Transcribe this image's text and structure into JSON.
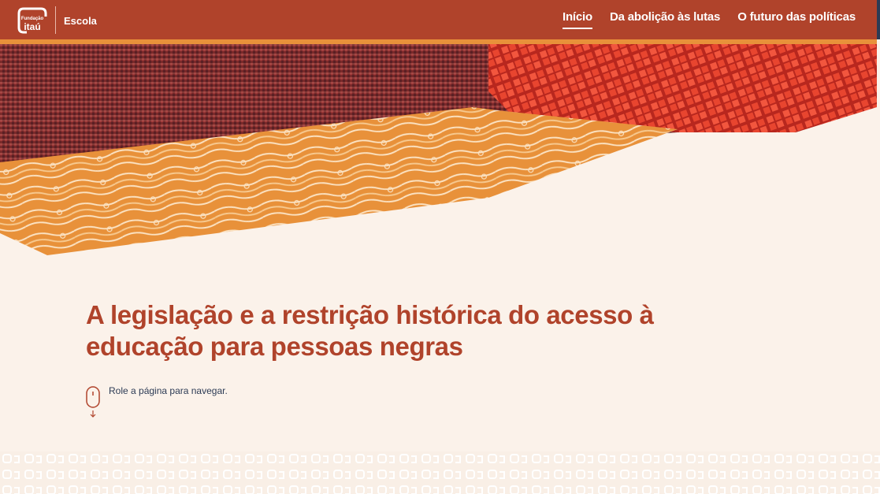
{
  "header": {
    "logo_small": "Fundação",
    "logo_big": "itaú",
    "section": "Escola",
    "nav": [
      {
        "label": "Início",
        "active": true
      },
      {
        "label": "Da abolição às lutas",
        "active": false
      },
      {
        "label": "O futuro das políticas",
        "active": false
      }
    ]
  },
  "main": {
    "title": "A legislação e a restrição histórica do acesso à educação para pessoas negras",
    "scroll_hint": "Role a página para navegar."
  },
  "colors": {
    "header_bg": "#b0432b",
    "accent_orange": "#e8913a",
    "page_bg": "#fbf2ea",
    "title": "#b0432b",
    "hint_text": "#2c3b55"
  }
}
